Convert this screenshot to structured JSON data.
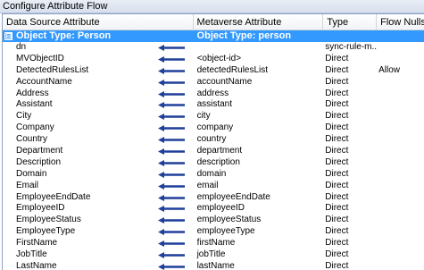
{
  "window": {
    "title": "Configure Attribute Flow"
  },
  "columns": {
    "source": "Data Source Attribute",
    "metaverse": "Metaverse Attribute",
    "type": "Type",
    "nulls": "Flow Nulls"
  },
  "group": {
    "toggle": "⊟",
    "source": "Object Type: Person",
    "metaverse": "Object Type: person"
  },
  "rows": [
    {
      "source": "dn",
      "metaverse": "",
      "type": "sync-rule-m...",
      "nulls": ""
    },
    {
      "source": "MVObjectID",
      "metaverse": "<object-id>",
      "type": "Direct",
      "nulls": ""
    },
    {
      "source": "DetectedRulesList",
      "metaverse": "detectedRulesList",
      "type": "Direct",
      "nulls": "Allow"
    },
    {
      "source": "AccountName",
      "metaverse": "accountName",
      "type": "Direct",
      "nulls": ""
    },
    {
      "source": "Address",
      "metaverse": "address",
      "type": "Direct",
      "nulls": ""
    },
    {
      "source": "Assistant",
      "metaverse": "assistant",
      "type": "Direct",
      "nulls": ""
    },
    {
      "source": "City",
      "metaverse": "city",
      "type": "Direct",
      "nulls": ""
    },
    {
      "source": "Company",
      "metaverse": "company",
      "type": "Direct",
      "nulls": ""
    },
    {
      "source": "Country",
      "metaverse": "country",
      "type": "Direct",
      "nulls": ""
    },
    {
      "source": "Department",
      "metaverse": "department",
      "type": "Direct",
      "nulls": ""
    },
    {
      "source": "Description",
      "metaverse": "description",
      "type": "Direct",
      "nulls": ""
    },
    {
      "source": "Domain",
      "metaverse": "domain",
      "type": "Direct",
      "nulls": ""
    },
    {
      "source": "Email",
      "metaverse": "email",
      "type": "Direct",
      "nulls": ""
    },
    {
      "source": "EmployeeEndDate",
      "metaverse": "employeeEndDate",
      "type": "Direct",
      "nulls": ""
    },
    {
      "source": "EmployeeID",
      "metaverse": "employeeID",
      "type": "Direct",
      "nulls": ""
    },
    {
      "source": "EmployeeStatus",
      "metaverse": "employeeStatus",
      "type": "Direct",
      "nulls": ""
    },
    {
      "source": "EmployeeType",
      "metaverse": "employeeType",
      "type": "Direct",
      "nulls": ""
    },
    {
      "source": "FirstName",
      "metaverse": "firstName",
      "type": "Direct",
      "nulls": ""
    },
    {
      "source": "JobTitle",
      "metaverse": "jobTitle",
      "type": "Direct",
      "nulls": ""
    },
    {
      "source": "LastName",
      "metaverse": "lastName",
      "type": "Direct",
      "nulls": ""
    }
  ],
  "colors": {
    "selection": "#3399ff",
    "arrow": "#1f3f9a"
  },
  "icons": {
    "flow": "left-arrow-icon"
  }
}
